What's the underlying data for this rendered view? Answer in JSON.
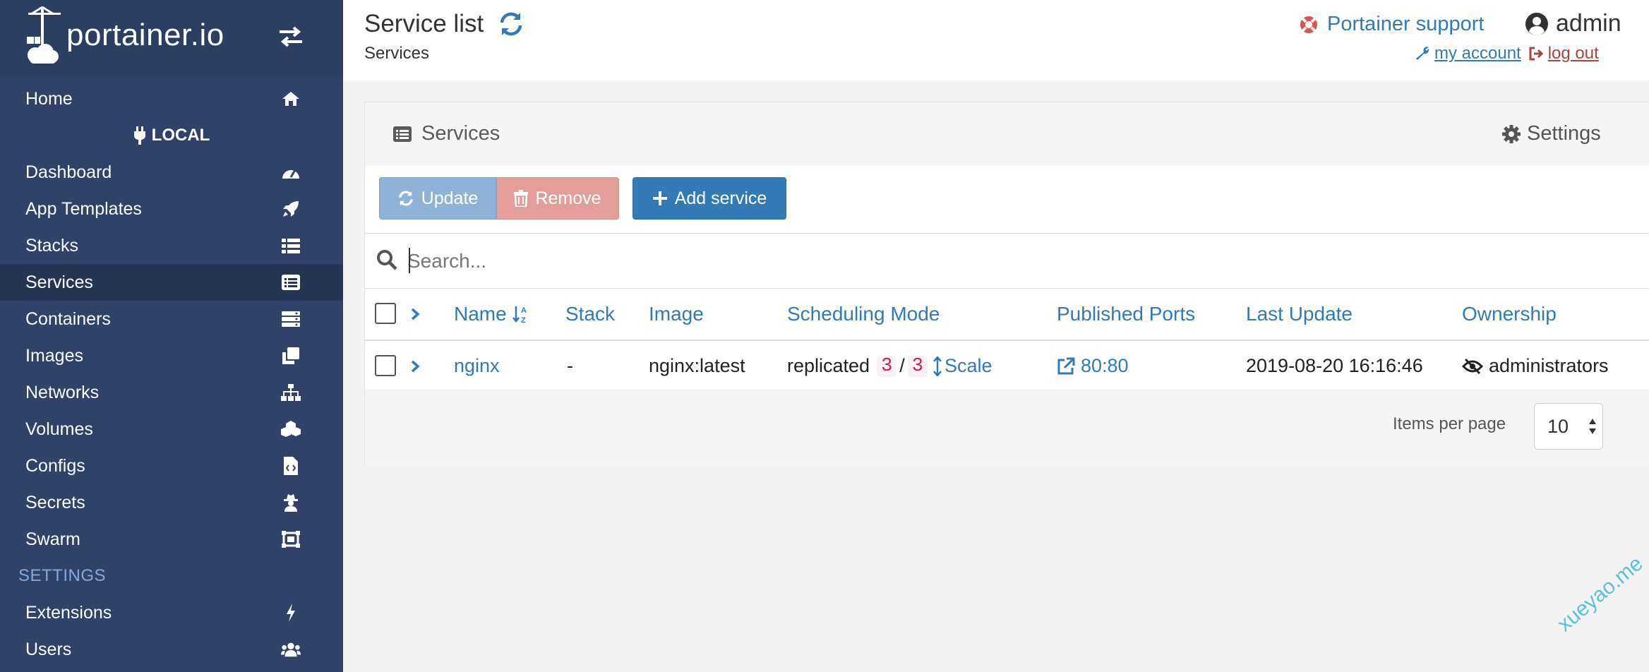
{
  "brand": {
    "name": "portainer.io"
  },
  "sidebar": {
    "home": "Home",
    "endpoint": "LOCAL",
    "items": [
      {
        "label": "Dashboard",
        "icon": "tachometer-icon"
      },
      {
        "label": "App Templates",
        "icon": "rocket-icon"
      },
      {
        "label": "Stacks",
        "icon": "list-icon"
      },
      {
        "label": "Services",
        "icon": "list-alt-icon",
        "active": true
      },
      {
        "label": "Containers",
        "icon": "server-icon"
      },
      {
        "label": "Images",
        "icon": "clone-icon"
      },
      {
        "label": "Networks",
        "icon": "sitemap-icon"
      },
      {
        "label": "Volumes",
        "icon": "cubes-icon"
      },
      {
        "label": "Configs",
        "icon": "file-code-icon"
      },
      {
        "label": "Secrets",
        "icon": "user-secret-icon"
      },
      {
        "label": "Swarm",
        "icon": "object-group-icon"
      }
    ],
    "settings_heading": "SETTINGS",
    "settings_items": [
      {
        "label": "Extensions",
        "icon": "bolt-icon"
      },
      {
        "label": "Users",
        "icon": "users-icon"
      }
    ]
  },
  "header": {
    "title": "Service list",
    "breadcrumb": "Services",
    "support": "Portainer support",
    "user": "admin",
    "my_account": "my account",
    "log_out": "log out"
  },
  "panel": {
    "title": "Services",
    "settings": "Settings",
    "actions": {
      "update": "Update",
      "remove": "Remove",
      "add": "Add service"
    },
    "search_placeholder": "Search...",
    "columns": [
      "Name",
      "Stack",
      "Image",
      "Scheduling Mode",
      "Published Ports",
      "Last Update",
      "Ownership"
    ],
    "rows": [
      {
        "name": "nginx",
        "stack": "-",
        "image": "nginx:latest",
        "mode": "replicated",
        "running": "3",
        "separator": "/",
        "desired": "3",
        "scale": "Scale",
        "ports": "80:80",
        "last_update": "2019-08-20 16:16:46",
        "ownership": "administrators"
      }
    ],
    "items_per_page_label": "Items per page",
    "items_per_page": "10"
  },
  "watermark": "xueyao.me",
  "colors": {
    "sidebar": "#30426a",
    "accent": "#337ab7",
    "danger": "#a94442"
  }
}
